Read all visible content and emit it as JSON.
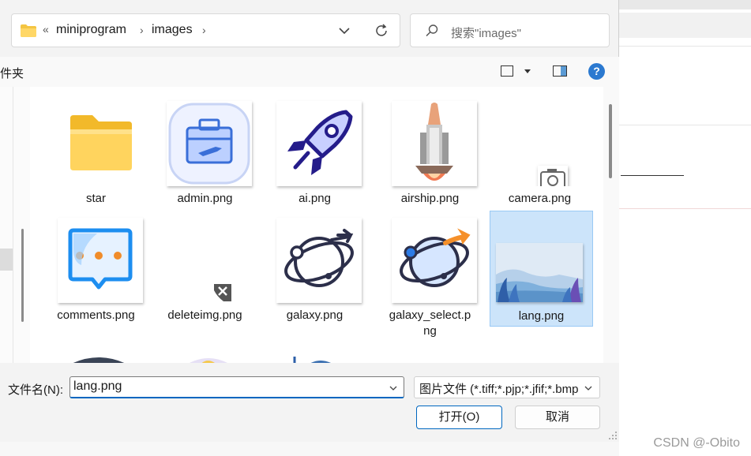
{
  "address": {
    "overflow_glyph": "«",
    "crumbs": [
      "miniprogram",
      "images"
    ],
    "separator": "›"
  },
  "search": {
    "placeholder": "搜索\"images\""
  },
  "toolbar": {
    "left_text": "件夹",
    "help_glyph": "?"
  },
  "files": [
    {
      "name": "star"
    },
    {
      "name": "admin.png"
    },
    {
      "name": "ai.png"
    },
    {
      "name": "airship.png"
    },
    {
      "name": "camera.png"
    },
    {
      "name": "comments.png"
    },
    {
      "name": "deleteimg.png"
    },
    {
      "name": "galaxy.png"
    },
    {
      "name": "galaxy_select.p\nng",
      "line1": "galaxy_select.p",
      "line2": "ng"
    },
    {
      "name": "lang.png",
      "selected": true
    }
  ],
  "bottom": {
    "filename_label": "文件名(N):",
    "filename_value": "lang.png",
    "filetype_value": "图片文件 (*.tiff;*.pjp;*.jfif;*.bmp",
    "open_label": "打开(O)",
    "cancel_label": "取消"
  },
  "watermark": "CSDN @-Obito",
  "colors": {
    "accent": "#0067c0",
    "selection": "#cce4fa",
    "help": "#2b79d0"
  }
}
